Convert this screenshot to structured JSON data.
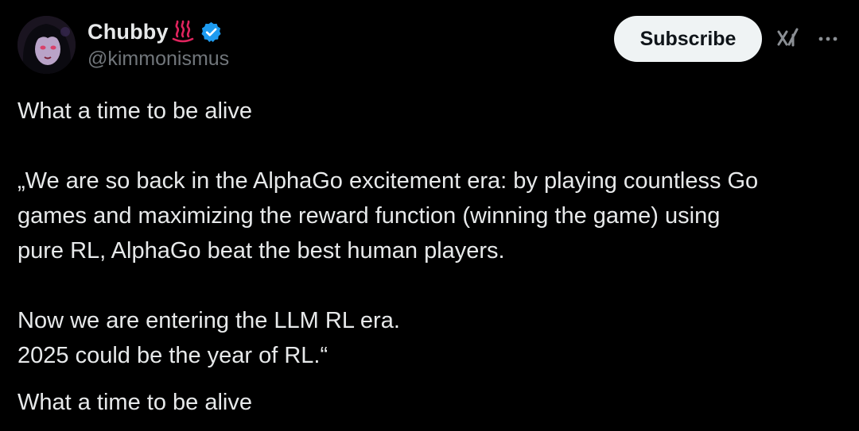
{
  "author": {
    "display_name": "Chubby",
    "handle": "@kimmonismus",
    "name_emoji_icon": "hot-springs-icon",
    "verified_icon": "verified-badge-icon",
    "verified_color": "#1d9bf0"
  },
  "actions": {
    "subscribe_label": "Subscribe",
    "grok_icon": "grok-icon",
    "more_icon": "more-icon"
  },
  "tweet": {
    "line1": "What a time to be alive",
    "quote_line1": "„We are so back in the AlphaGo excitement era: by playing countless Go",
    "quote_line2": "games and maximizing the reward function (winning the game) using",
    "quote_line3": "pure RL, AlphaGo beat the best human players.",
    "quote_line4": "Now we are entering the LLM RL era.",
    "quote_line5": "2025 could be the year of RL.“",
    "line_last": "What a time to be alive"
  },
  "colors": {
    "background": "#000000",
    "text": "#e7e9ea",
    "secondary_text": "#71767b",
    "button_bg": "#eff3f4",
    "button_text": "#0f1419",
    "accent_red": "#e0245e"
  }
}
